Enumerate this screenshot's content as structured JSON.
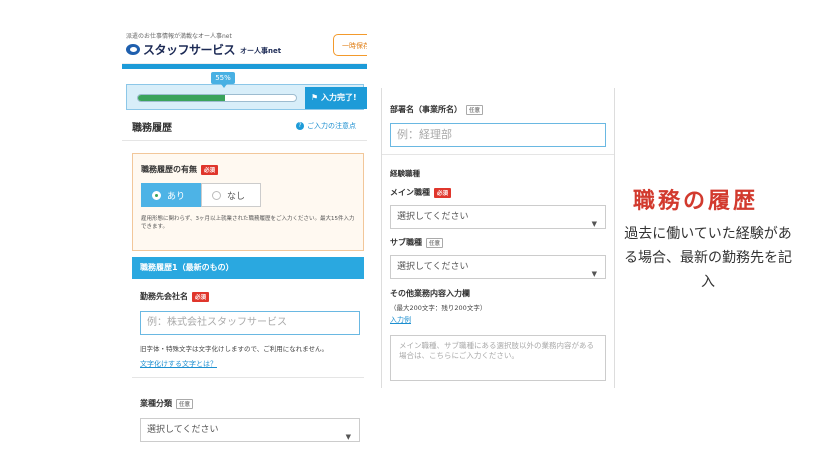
{
  "header": {
    "tagline": "派遣のお仕事情報が満載なオー人事net",
    "logo_text": "スタッフサービス",
    "logo_sub": "オー人事net",
    "save_button": "一時保存"
  },
  "progress": {
    "percent_label": "55%",
    "percent_value": 55,
    "done_button": "入力完了!",
    "done_icon": "flag-icon"
  },
  "section": {
    "title": "職務履歴",
    "help_link": "ご入力の注意点",
    "help_icon": "question-icon"
  },
  "history_presence": {
    "label": "職務履歴の有無",
    "required_badge": "必須",
    "options": [
      {
        "label": "あり",
        "selected": true
      },
      {
        "label": "なし",
        "selected": false
      }
    ],
    "note": "雇用形態に関わらず、3ヶ月以上就業された職務履歴をご入力ください。最大15件入力できます。"
  },
  "history_item": {
    "bar_title": "職務履歴1（最新のもの）",
    "company": {
      "label": "勤務先会社名",
      "required_badge": "必須",
      "placeholder": "例：株式会社スタッフサービス",
      "note": "旧字体・特殊文字は文字化けしますので、ご利用になれません。",
      "link": "文字化けする文字とは？"
    },
    "industry": {
      "label": "業種分類",
      "optional_badge": "任意",
      "select_value": "選択してください"
    }
  },
  "right_panel": {
    "department": {
      "label": "部署名（事業所名）",
      "optional_badge": "任意",
      "placeholder": "例：経理部"
    },
    "experience_heading": "経験職種",
    "main_job": {
      "label": "メイン職種",
      "required_badge": "必須",
      "select_value": "選択してください"
    },
    "sub_job": {
      "label": "サブ職種",
      "optional_badge": "任意",
      "select_value": "選択してください"
    },
    "other_duties": {
      "label": "その他業務内容入力欄",
      "limit": "（最大200文字：残り200文字）",
      "example_link": "入力例",
      "placeholder": "メイン職種、サブ職種にある選択肢以外の業務内容がある場合は、こちらにご入力ください。"
    }
  },
  "caption": {
    "title": "職務の履歴",
    "body": "過去に働いていた経験がある場合、最新の勤務先を記入"
  },
  "colors": {
    "brand_blue": "#1d9bd8",
    "required_red": "#e0362c",
    "caption_red": "#d23a2e",
    "progress_green": "#3aa35b",
    "save_orange": "#f39a2c"
  }
}
